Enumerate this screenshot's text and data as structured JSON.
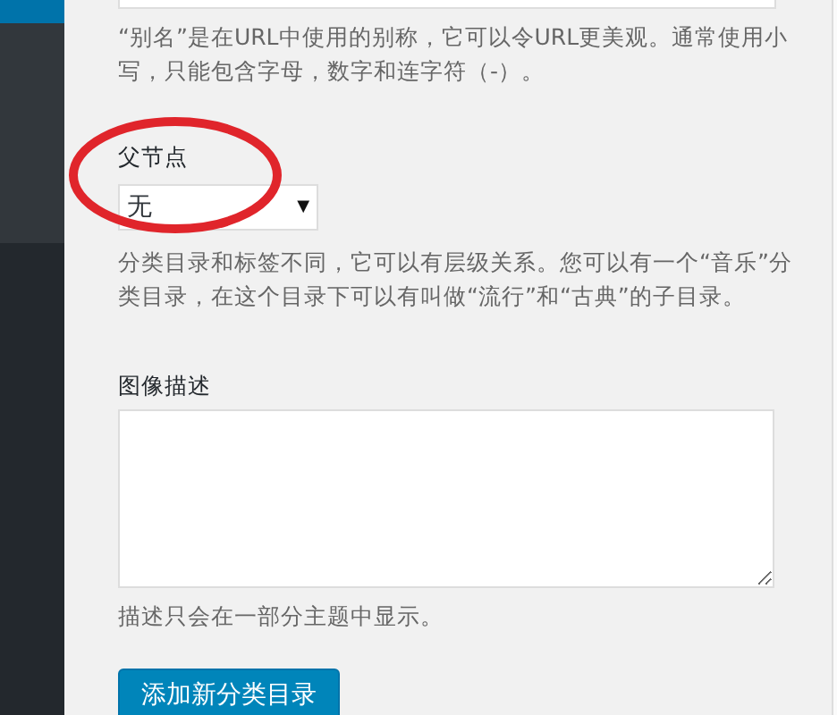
{
  "slug_help": "“别名”是在URL中使用的别称，它可以令URL更美观。通常使用小写，只能包含字母，数字和连字符（-）。",
  "parent": {
    "label": "父节点",
    "value": "无",
    "arrow": "▼",
    "help": "分类目录和标签不同，它可以有层级关系。您可以有一个“音乐”分类目录，在这个目录下可以有叫做“流行”和“古典”的子目录。",
    "highlighted": true
  },
  "description": {
    "label": "图像描述",
    "help": "描述只会在一部分主题中显示。"
  },
  "submit_button": "添加新分类目录"
}
